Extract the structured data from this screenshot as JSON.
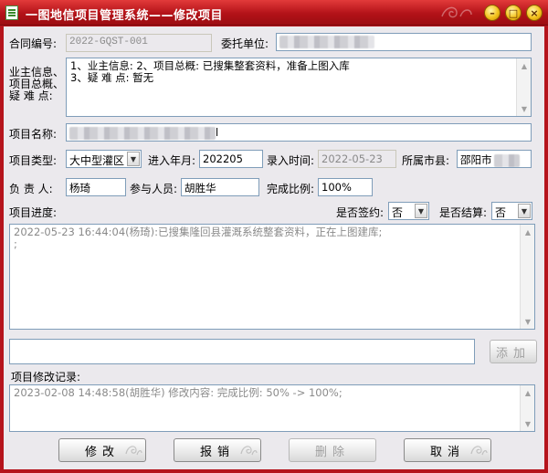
{
  "window": {
    "title": "一图地信项目管理系统——修改项目",
    "minimize_glyph": "–",
    "maximize_glyph": "□",
    "close_glyph": "×",
    "icon": "app-document-icon",
    "accent_color": "#b5141c"
  },
  "form": {
    "contract_no_label": "合同编号:",
    "contract_no_value": "2022-GQST-001",
    "client_label": "委托单位:",
    "summary_labels": [
      "业主信息、",
      "项目总概、",
      "疑 难 点:"
    ],
    "summary_lines": [
      "1、业主信息: 2、项目总概: 已搜集整套资料，准备上图入库",
      "3、疑 难 点: 暂无"
    ],
    "project_name_label": "项目名称:",
    "project_name_tail": "l",
    "type_label": "项目类型:",
    "type_value": "大中型灌区",
    "entry_month_label": "进入年月:",
    "entry_month_value": "202205",
    "record_time_label": "录入时间:",
    "record_time_value": "2022-05-23",
    "city_label": "所属市县:",
    "city_value": "邵阳市",
    "manager_label": "负 责 人:",
    "manager_value": "杨琦",
    "participants_label": "参与人员:",
    "participants_value": "胡胜华",
    "completion_label": "完成比例:",
    "completion_value": "100%",
    "progress_label": "项目进度:",
    "signed_label": "是否签约:",
    "signed_value": "否",
    "settled_label": "是否结算:",
    "settled_value": "否"
  },
  "progress_log": [
    "2022-05-23 16:44:04(杨琦):已搜集隆回县灌溉系统整套资料，正在上图建库;",
    ";"
  ],
  "new_progress_input": "",
  "add_button_label": "添加",
  "history_label": "项目修改记录:",
  "history_log": [
    "2023-02-08 14:48:58(胡胜华) 修改内容: 完成比例: 50% -> 100%;"
  ],
  "buttons": {
    "modify": "修改",
    "report": "报销",
    "delete": "删除",
    "cancel": "取消"
  }
}
